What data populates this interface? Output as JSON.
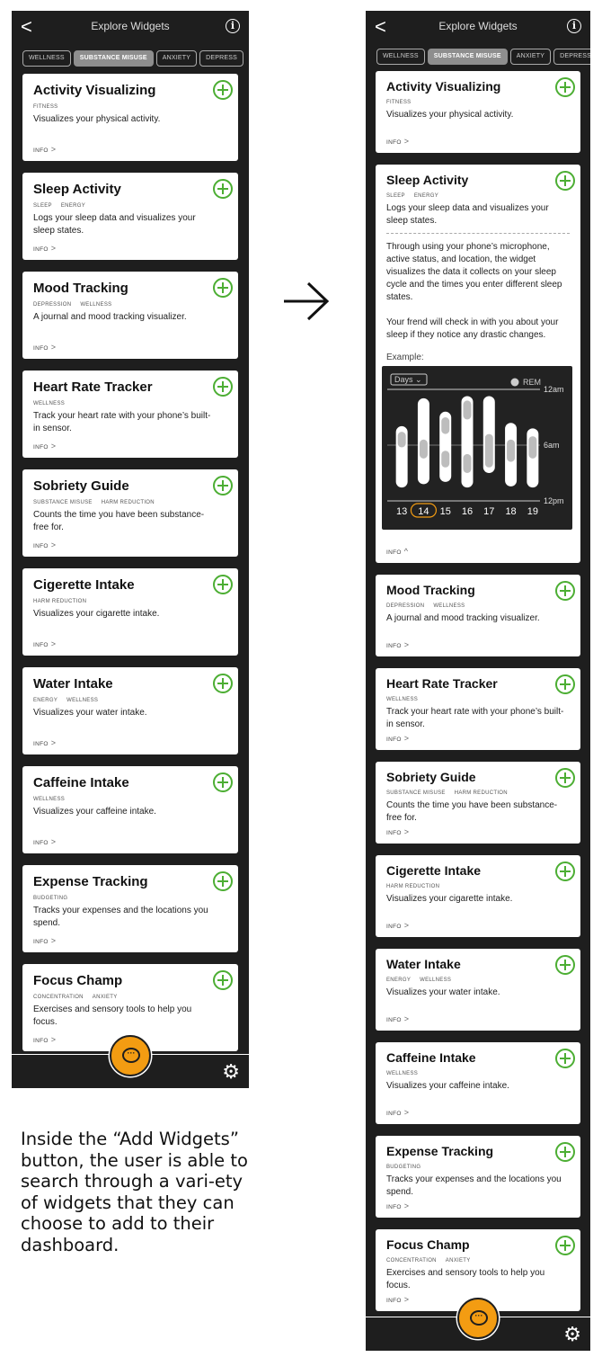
{
  "screens": [
    {
      "title": "Explore Widgets",
      "back_glyph": "<",
      "info_glyph": "i",
      "filters": [
        {
          "label": "WELLNESS",
          "active": false
        },
        {
          "label": "SUBSTANCE MISUSE",
          "active": true
        },
        {
          "label": "ANXIETY",
          "active": false
        },
        {
          "label": "DEPRESS",
          "active": false
        }
      ],
      "widgets": [
        {
          "name": "Activity Visualizing",
          "tags": [
            "FITNESS"
          ],
          "desc": "Visualizes your physical activity.",
          "info": "INFO"
        },
        {
          "name": "Sleep Activity",
          "tags": [
            "SLEEP",
            "ENERGY"
          ],
          "desc": "Logs your sleep data and visualizes your sleep states.",
          "info": "INFO"
        },
        {
          "name": "Mood Tracking",
          "tags": [
            "DEPRESSION",
            "WELLNESS"
          ],
          "desc": "A journal and mood tracking visualizer.",
          "info": "INFO"
        },
        {
          "name": "Heart Rate Tracker",
          "tags": [
            "WELLNESS"
          ],
          "desc": "Track your heart rate with your phone’s built-in sensor.",
          "info": "INFO"
        },
        {
          "name": "Sobriety Guide",
          "tags": [
            "SUBSTANCE MISUSE",
            "HARM REDUCTION"
          ],
          "desc": "Counts the time you have been substance-free for.",
          "info": "INFO"
        },
        {
          "name": "Cigerette Intake",
          "tags": [
            "HARM REDUCTION"
          ],
          "desc": "Visualizes your cigarette intake.",
          "info": "INFO"
        },
        {
          "name": "Water Intake",
          "tags": [
            "ENERGY",
            "WELLNESS"
          ],
          "desc": "Visualizes your water intake.",
          "info": "INFO"
        },
        {
          "name": "Caffeine Intake",
          "tags": [
            "WELLNESS"
          ],
          "desc": "Visualizes your caffeine intake.",
          "info": "INFO"
        },
        {
          "name": "Expense Tracking",
          "tags": [
            "BUDGETING"
          ],
          "desc": "Tracks your expenses and the locations you spend.",
          "info": "INFO"
        },
        {
          "name": "Focus Champ",
          "tags": [
            "CONCENTRATION",
            "ANXIETY"
          ],
          "desc": "Exercises and sensory tools to help you focus.",
          "info": "INFO"
        }
      ]
    },
    {
      "title": "Explore Widgets",
      "back_glyph": "<",
      "info_glyph": "i",
      "filters": [
        {
          "label": "WELLNESS",
          "active": false
        },
        {
          "label": "SUBSTANCE MISUSE",
          "active": true
        },
        {
          "label": "ANXIETY",
          "active": false
        },
        {
          "label": "DEPRESS",
          "active": false
        }
      ],
      "widgets": [
        {
          "name": "Activity Visualizing",
          "tags": [
            "FITNESS"
          ],
          "desc": "Visualizes your physical activity.",
          "info": "INFO"
        },
        {
          "name": "Sleep Activity",
          "tags": [
            "SLEEP",
            "ENERGY"
          ],
          "desc": "Logs your sleep data and visualizes your sleep states.",
          "info": "INFO",
          "expanded": true,
          "details": [
            "Through using your phone’s microphone, active status, and location, the widget visualizes the data it collects on your sleep cycle and the times you enter different sleep states.",
            "Your frend will check in with you about your sleep if they notice any drastic changes."
          ],
          "example_label": "Example:"
        },
        {
          "name": "Mood Tracking",
          "tags": [
            "DEPRESSION",
            "WELLNESS"
          ],
          "desc": "A journal and mood tracking visualizer.",
          "info": "INFO"
        },
        {
          "name": "Heart Rate Tracker",
          "tags": [
            "WELLNESS"
          ],
          "desc": "Track your heart rate with your phone’s built-in sensor.",
          "info": "INFO"
        },
        {
          "name": "Sobriety Guide",
          "tags": [
            "SUBSTANCE MISUSE",
            "HARM REDUCTION"
          ],
          "desc": "Counts the time you have been substance-free for.",
          "info": "INFO"
        },
        {
          "name": "Cigerette Intake",
          "tags": [
            "HARM REDUCTION"
          ],
          "desc": "Visualizes your cigarette intake.",
          "info": "INFO"
        },
        {
          "name": "Water Intake",
          "tags": [
            "ENERGY",
            "WELLNESS"
          ],
          "desc": "Visualizes your water intake.",
          "info": "INFO"
        },
        {
          "name": "Caffeine Intake",
          "tags": [
            "WELLNESS"
          ],
          "desc": "Visualizes your caffeine intake.",
          "info": "INFO"
        },
        {
          "name": "Expense Tracking",
          "tags": [
            "BUDGETING"
          ],
          "desc": "Tracks your expenses and the locations you spend.",
          "info": "INFO"
        },
        {
          "name": "Focus Champ",
          "tags": [
            "CONCENTRATION",
            "ANXIETY"
          ],
          "desc": "Exercises and sensory tools to help you focus.",
          "info": "INFO"
        }
      ]
    }
  ],
  "caption": "Inside the “Add Widgets” button, the user is able to search through a vari-ety of widgets that they can choose to add to their dashboard.",
  "colors": {
    "add_green": "#4cae33",
    "chat_orange": "#f39c12",
    "phone_bg": "#1e1e1e"
  },
  "icons": {
    "back": "chevron-left-icon",
    "info": "info-icon",
    "add": "plus-circle-icon",
    "chat": "chat-bubble-icon",
    "settings": "gear-icon",
    "arrow": "right-arrow-icon"
  },
  "chart_data": {
    "type": "range-bar",
    "dropdown": "Days",
    "legend": "REM",
    "y_labels": [
      "12am",
      "6am",
      "12pm"
    ],
    "x_labels": [
      "13",
      "14",
      "15",
      "16",
      "17",
      "18",
      "19"
    ],
    "selected_day": "14",
    "sleep_ranges": [
      {
        "day": "13",
        "start": 0.33,
        "end": 0.88,
        "rem": [
          [
            0.38,
            0.52
          ]
        ]
      },
      {
        "day": "14",
        "start": 0.08,
        "end": 0.85,
        "rem": [
          [
            0.45,
            0.62
          ]
        ]
      },
      {
        "day": "15",
        "start": 0.2,
        "end": 0.83,
        "rem": [
          [
            0.25,
            0.4
          ],
          [
            0.55,
            0.7
          ]
        ]
      },
      {
        "day": "16",
        "start": 0.06,
        "end": 0.88,
        "rem": [
          [
            0.1,
            0.27
          ],
          [
            0.58,
            0.75
          ]
        ]
      },
      {
        "day": "17",
        "start": 0.06,
        "end": 0.75,
        "rem": [
          [
            0.4,
            0.7
          ]
        ]
      },
      {
        "day": "18",
        "start": 0.3,
        "end": 0.87,
        "rem": [
          [
            0.45,
            0.65
          ]
        ]
      },
      {
        "day": "19",
        "start": 0.35,
        "end": 0.88,
        "rem": [
          [
            0.42,
            0.62
          ]
        ]
      }
    ]
  }
}
